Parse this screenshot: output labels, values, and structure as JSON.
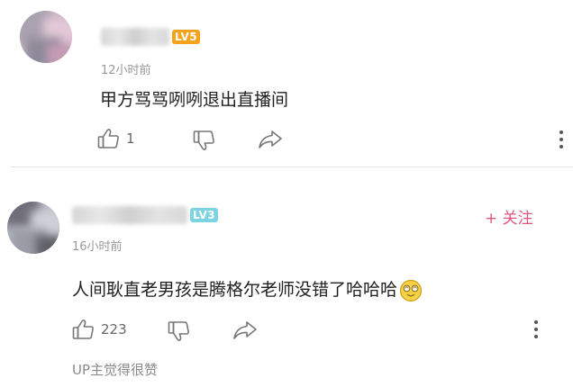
{
  "colors": {
    "accent": "#e0567a",
    "level5": "#f5a21c",
    "level3": "#7ed3e3"
  },
  "comments": [
    {
      "level": "LV5",
      "time": "12小时前",
      "text": "甲方骂骂咧咧退出直播间",
      "likes": "1"
    },
    {
      "level": "LV3",
      "time": "16小时前",
      "text": "人间耿直老男孩是腾格尔老师没错了哈哈哈",
      "emoji": "dizzy-face-emoji",
      "likes": "223",
      "follow_label": "+ 关注",
      "up_liked": "UP主觉得很赞"
    }
  ]
}
